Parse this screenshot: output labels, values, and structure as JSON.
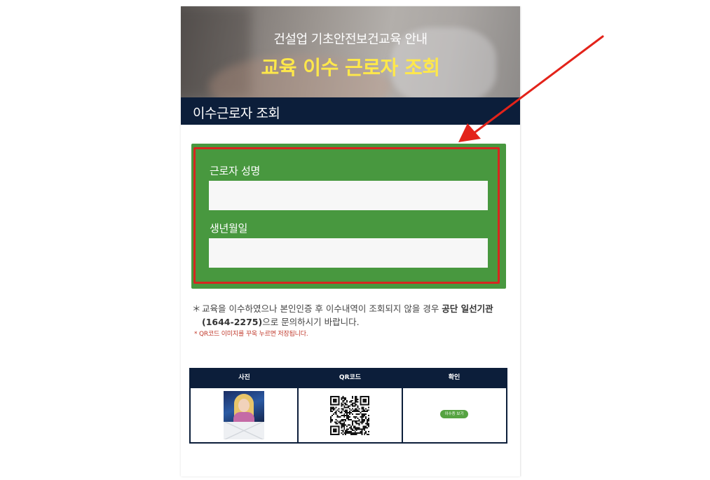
{
  "hero": {
    "subtitle": "건설업 기초안전보건교육 안내",
    "title": "교육 이수 근로자 조회"
  },
  "section": {
    "title": "이수근로자 조회"
  },
  "form": {
    "name_label": "근로자 성명",
    "name_value": "",
    "birth_label": "생년월일",
    "birth_value": ""
  },
  "notice": {
    "mark": "＊",
    "text_before": "교육을 이수하였으나 본인인증 후 이수내역이 조회되지 않을 경우 ",
    "org": "공단 일선기관(1644-2275)",
    "text_after": "으로 문의하시기 바랍니다.",
    "qr_note": "* QR코드 이미지를 꾸욱 누르면 저장됩니다."
  },
  "table": {
    "headers": [
      "사진",
      "QR코드",
      "확인"
    ],
    "view_button": "이수증 보기"
  },
  "colors": {
    "navy": "#0c1e3a",
    "green": "#48983f",
    "highlight_red": "#d7261f",
    "title_yellow": "#ffe84a"
  }
}
